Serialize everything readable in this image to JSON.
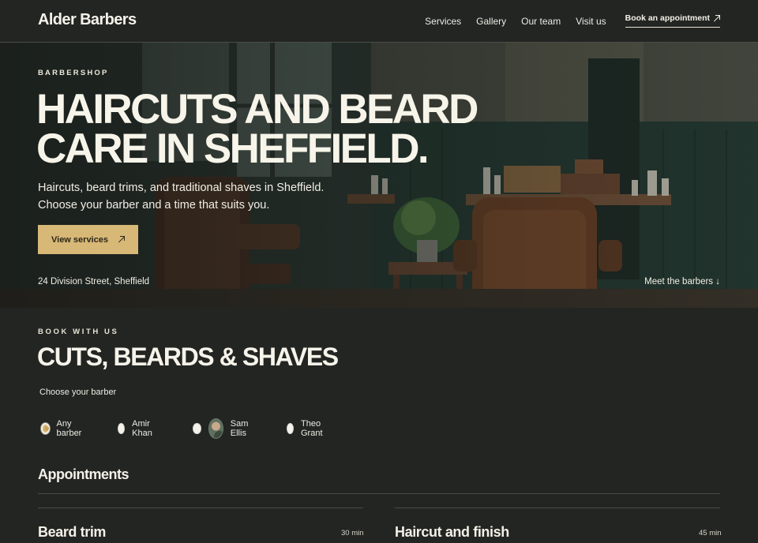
{
  "header": {
    "brand": "Alder Barbers",
    "nav": [
      "Services",
      "Gallery",
      "Our team",
      "Visit us"
    ],
    "cta_label": "Book an appointment",
    "cta_icon": "arrow-up-right-icon"
  },
  "hero": {
    "eyebrow": "BARBERSHOP",
    "title_line1": "HAIRCUTS AND BEARD",
    "title_line2": "CARE IN SHEFFIELD.",
    "subtitle": "Haircuts, beard trims, and traditional shaves in Sheffield. Choose your barber and a time that suits you.",
    "button_label": "View services",
    "button_icon": "arrow-up-right-icon",
    "address": "24 Division Street, Sheffield",
    "meet_link": "Meet the barbers ↓"
  },
  "booking": {
    "eyebrow": "BOOK WITH US",
    "title": "CUTS, BEARDS & SHAVES",
    "choose_label": "Choose your barber",
    "barbers": [
      {
        "label": "Any barber",
        "selected": true
      },
      {
        "label": "Amir Khan",
        "selected": false
      },
      {
        "label": "Sam Ellis",
        "selected": false
      },
      {
        "label": "Theo Grant",
        "selected": false
      }
    ],
    "appointments_heading": "Appointments",
    "services": [
      {
        "name": "Beard trim",
        "duration": "30 min"
      },
      {
        "name": "Haircut and finish",
        "duration": "45 min"
      }
    ]
  },
  "colors": {
    "background": "#232522",
    "accent": "#d8b877",
    "text": "#f4f1e8"
  }
}
